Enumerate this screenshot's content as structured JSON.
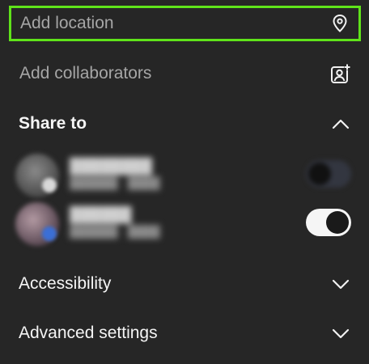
{
  "location": {
    "label": "Add location",
    "icon": "location-pin-icon"
  },
  "collaborators": {
    "label": "Add collaborators",
    "icon": "add-person-icon"
  },
  "share_to": {
    "label": "Share to",
    "icon": "chevron-up-icon",
    "accounts": [
      {
        "name": "████████",
        "subtitle": "██████ · ████",
        "enabled": false
      },
      {
        "name": "██████",
        "subtitle": "██████ · ████",
        "enabled": true
      }
    ]
  },
  "accessibility": {
    "label": "Accessibility",
    "icon": "chevron-down-icon"
  },
  "advanced": {
    "label": "Advanced settings",
    "icon": "chevron-down-icon"
  },
  "colors": {
    "background": "#262626",
    "highlight_border": "#5fe31a",
    "toggle_on": "#f5f5f5"
  }
}
